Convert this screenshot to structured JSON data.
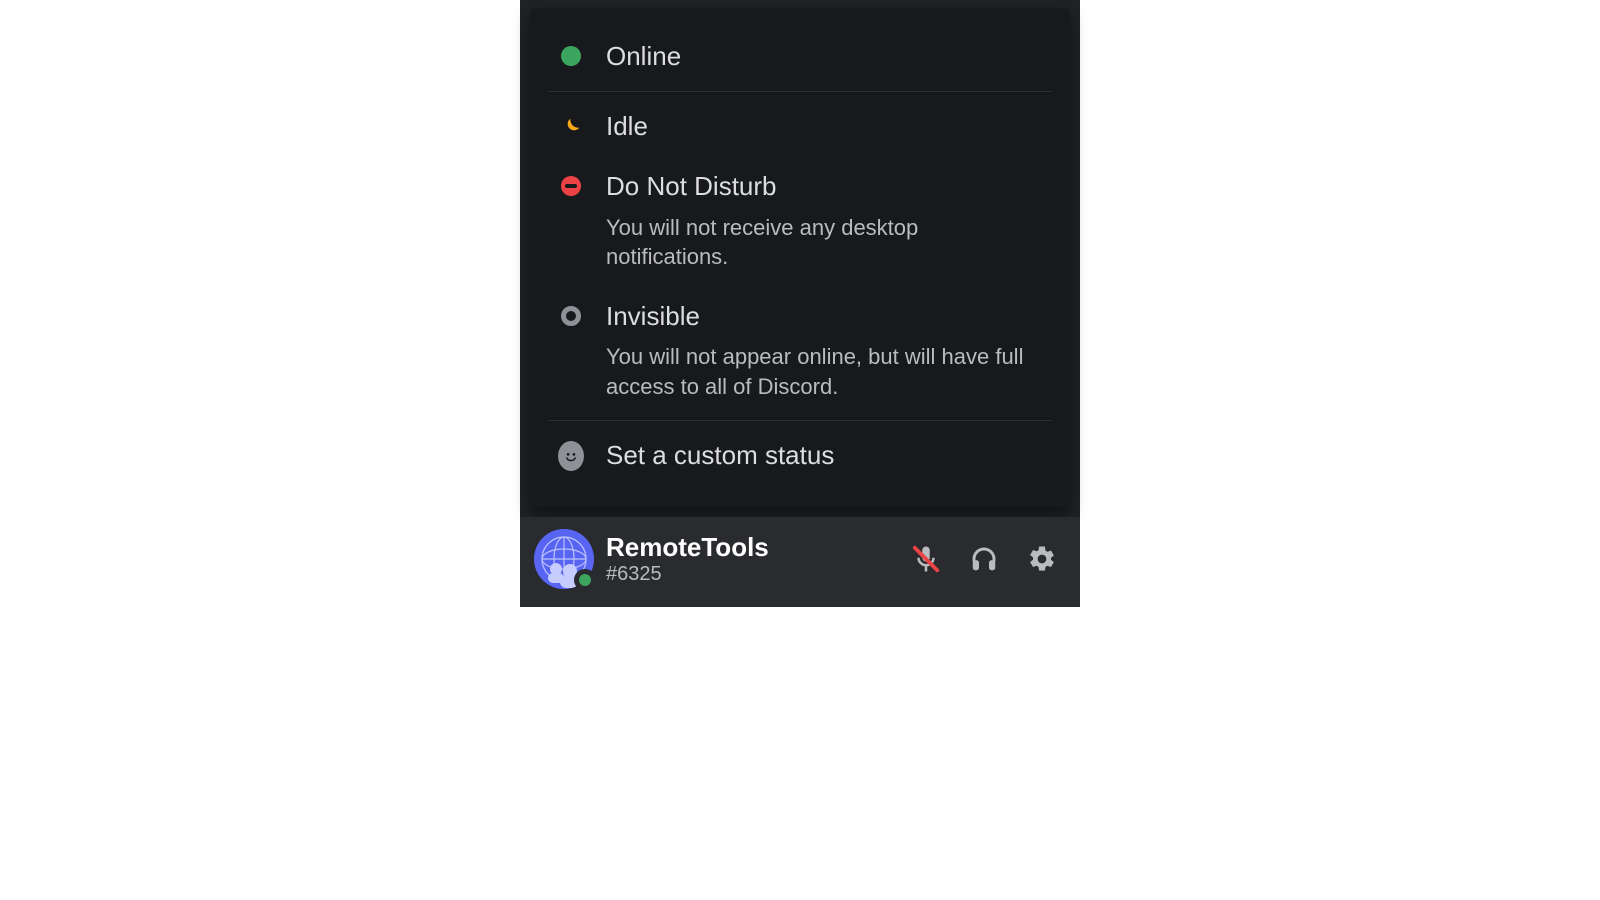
{
  "status_menu": {
    "online": {
      "label": "Online"
    },
    "idle": {
      "label": "Idle"
    },
    "dnd": {
      "label": "Do Not Disturb",
      "desc": "You will not receive any desktop notifications."
    },
    "invisible": {
      "label": "Invisible",
      "desc": "You will not appear online, but will have full access to all of Discord."
    },
    "custom": {
      "label": "Set a custom status"
    }
  },
  "user": {
    "name": "RemoteTools",
    "discriminator": "#6325",
    "status": "online"
  },
  "colors": {
    "online": "#3ba55d",
    "idle": "#faa81a",
    "dnd": "#ed4245",
    "offline": "#8e9297",
    "bg_popover": "#18191c",
    "bg_panel": "#202225",
    "bg_userbar": "#292b2f",
    "text_primary": "#dcddde",
    "text_secondary": "#b9bbbe"
  }
}
